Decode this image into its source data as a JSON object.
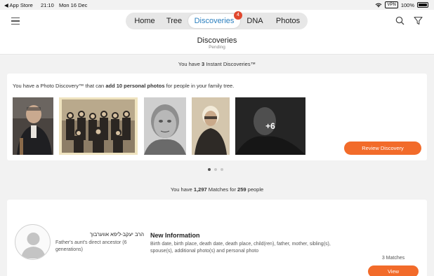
{
  "status_bar": {
    "back_app": "◀ App Store",
    "time": "21:10",
    "date": "Mon 16 Dec",
    "vpn": "VPN",
    "battery": "100%"
  },
  "nav": {
    "tabs": [
      "Home",
      "Tree",
      "Discoveries",
      "DNA",
      "Photos"
    ],
    "active_tab": "Discoveries",
    "discoveries_badge": "4"
  },
  "page": {
    "title": "Discoveries",
    "subtitle": "Pending"
  },
  "instant": {
    "prefix": "You have ",
    "count": "3",
    "suffix": " Instant Discoveries™"
  },
  "photo_discovery": {
    "prefix": "You have a Photo Discovery™ that can ",
    "bold": "add 10 personal photos",
    "suffix": " for people in your family tree.",
    "more_count": "+6",
    "review_button": "Review Discovery"
  },
  "matches_summary": {
    "prefix": "You have ",
    "matches": "1,297",
    "middle": " Matches for ",
    "people": "259",
    "suffix": " people"
  },
  "match_card": {
    "name": "הרב יעקב-ליפא אווערבוך",
    "relation": "Father's aunt's direct ancestor (6 generations)",
    "new_info_title": "New Information",
    "new_info_text": "Birth date, birth place, death date, death place, child(ren), father, mother, sibling(s), spouse(s), additional photo(s) and personal photo",
    "matches_count": "3 Matches",
    "view_button": "View"
  },
  "colors": {
    "accent_orange": "#f26b2a",
    "active_tab_blue": "#2a7fbf",
    "badge_red": "#e0482e"
  }
}
